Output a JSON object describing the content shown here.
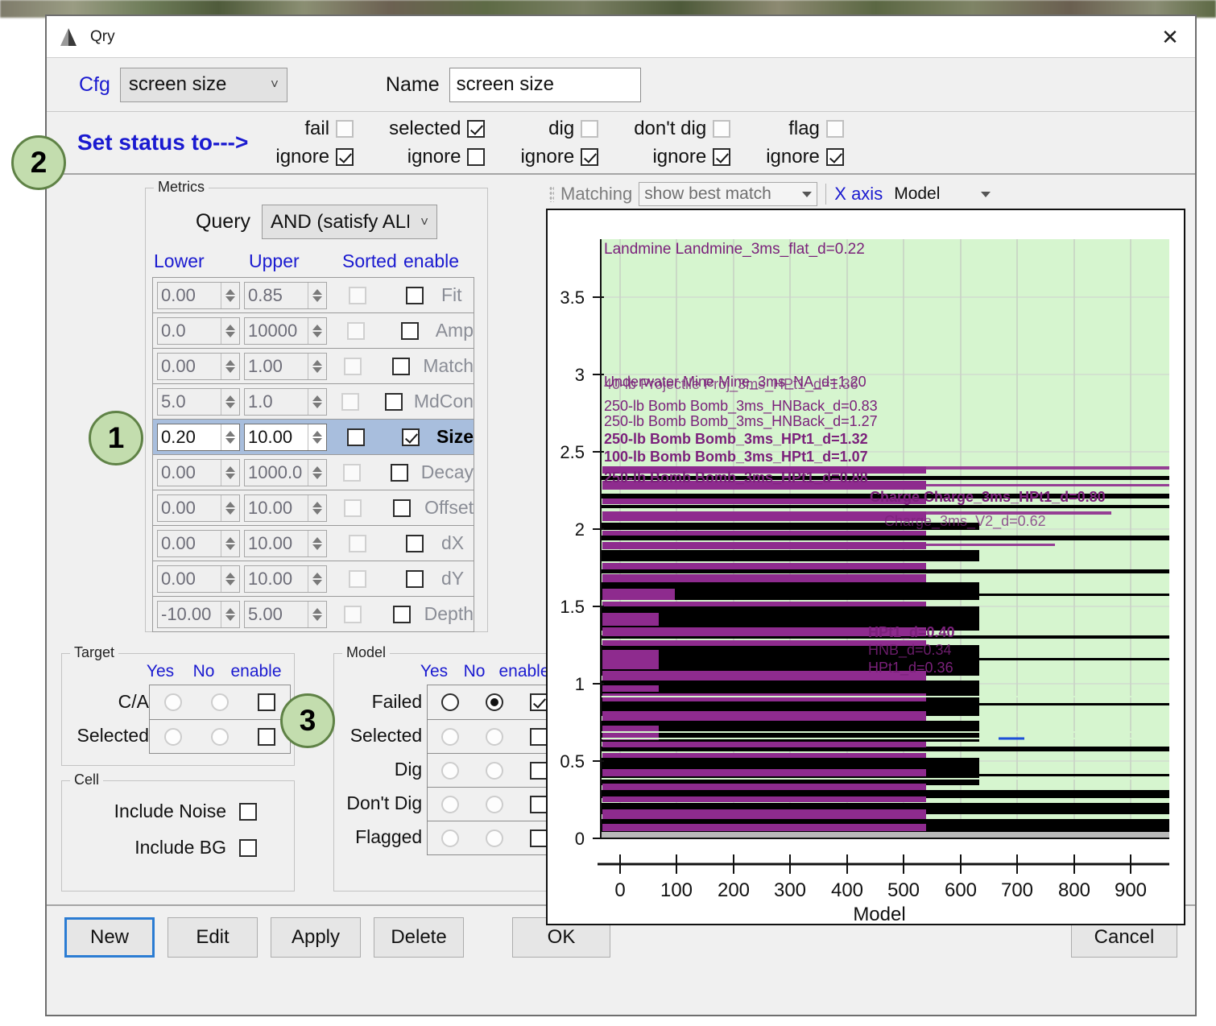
{
  "window": {
    "title": "Qry",
    "close_label": "✕"
  },
  "cfg_row": {
    "cfg_label": "Cfg",
    "cfg_value": "screen size",
    "name_label": "Name",
    "name_value": "screen size"
  },
  "status_row": {
    "title": "Set status to--->",
    "groups": [
      {
        "name": "fail",
        "top_label": "fail",
        "top_checked": false,
        "top_enabled": false,
        "ignore_label": "ignore",
        "ignore_checked": true
      },
      {
        "name": "selected",
        "top_label": "selected",
        "top_checked": true,
        "top_enabled": true,
        "ignore_label": "ignore",
        "ignore_checked": false
      },
      {
        "name": "dig",
        "top_label": "dig",
        "top_checked": false,
        "top_enabled": false,
        "ignore_label": "ignore",
        "ignore_checked": true
      },
      {
        "name": "dont-dig",
        "top_label": "don't dig",
        "top_checked": false,
        "top_enabled": false,
        "ignore_label": "ignore",
        "ignore_checked": true
      },
      {
        "name": "flag",
        "top_label": "flag",
        "top_checked": false,
        "top_enabled": false,
        "ignore_label": "ignore",
        "ignore_checked": true
      }
    ]
  },
  "metrics": {
    "group_title": "Metrics",
    "query_label": "Query",
    "query_value": "AND (satisfy ALL)",
    "headers": {
      "lower": "Lower",
      "upper": "Upper",
      "sorted": "Sorted",
      "enable": "enable"
    },
    "rows": [
      {
        "name": "Fit",
        "lower": "0.00",
        "upper": "0.85",
        "sorted": false,
        "enabled": false,
        "selected": false
      },
      {
        "name": "Amp",
        "lower": "0.0",
        "upper": "10000",
        "sorted": false,
        "enabled": false,
        "selected": false
      },
      {
        "name": "Match",
        "lower": "0.00",
        "upper": "1.00",
        "sorted": false,
        "enabled": false,
        "selected": false
      },
      {
        "name": "MdCon",
        "lower": "5.0",
        "upper": "1.0",
        "sorted": false,
        "enabled": false,
        "selected": false
      },
      {
        "name": "Size",
        "lower": "0.20",
        "upper": "10.00",
        "sorted": false,
        "enabled": true,
        "selected": true
      },
      {
        "name": "Decay",
        "lower": "0.00",
        "upper": "1000.0",
        "sorted": false,
        "enabled": false,
        "selected": false
      },
      {
        "name": "Offset",
        "lower": "0.00",
        "upper": "10.00",
        "sorted": false,
        "enabled": false,
        "selected": false
      },
      {
        "name": "dX",
        "lower": "0.00",
        "upper": "10.00",
        "sorted": false,
        "enabled": false,
        "selected": false
      },
      {
        "name": "dY",
        "lower": "0.00",
        "upper": "10.00",
        "sorted": false,
        "enabled": false,
        "selected": false
      },
      {
        "name": "Depth",
        "lower": "-10.00",
        "upper": "5.00",
        "sorted": false,
        "enabled": false,
        "selected": false
      }
    ]
  },
  "target": {
    "group_title": "Target",
    "headers": {
      "yes": "Yes",
      "no": "No",
      "enable": "enable"
    },
    "rows": [
      {
        "label": "C/A",
        "yes": false,
        "no": false,
        "active": false,
        "enable": false
      },
      {
        "label": "Selected",
        "yes": false,
        "no": false,
        "active": false,
        "enable": false
      }
    ]
  },
  "cell": {
    "group_title": "Cell",
    "rows": [
      {
        "label": "Include Noise",
        "checked": false
      },
      {
        "label": "Include BG",
        "checked": false
      }
    ]
  },
  "model": {
    "group_title": "Model",
    "headers": {
      "yes": "Yes",
      "no": "No",
      "enable": "enable"
    },
    "rows": [
      {
        "label": "Failed",
        "yes": false,
        "no": true,
        "active": true,
        "enable": true
      },
      {
        "label": "Selected",
        "yes": false,
        "no": false,
        "active": false,
        "enable": false
      },
      {
        "label": "Dig",
        "yes": false,
        "no": false,
        "active": false,
        "enable": false
      },
      {
        "label": "Don't Dig",
        "yes": false,
        "no": false,
        "active": false,
        "enable": false
      },
      {
        "label": "Flagged",
        "yes": false,
        "no": false,
        "active": false,
        "enable": false
      }
    ]
  },
  "plot_toolbar": {
    "matching_label": "Matching",
    "matching_value": "show best match",
    "xaxis_label": "X axis",
    "xaxis_value": "Model"
  },
  "badges": [
    {
      "number": "1"
    },
    {
      "number": "2"
    },
    {
      "number": "3"
    }
  ],
  "footer": {
    "new": "New",
    "edit": "Edit",
    "apply": "Apply",
    "delete": "Delete",
    "ok": "OK",
    "cancel": "Cancel"
  },
  "chart_data": {
    "type": "scatter",
    "title": "",
    "xlabel": "Model",
    "ylabel": "",
    "xlim": [
      -30,
      970
    ],
    "ylim": [
      -0.12,
      3.9
    ],
    "xticks": [
      0,
      100,
      200,
      300,
      400,
      500,
      600,
      700,
      800,
      900
    ],
    "yticks": [
      0,
      0.5,
      1,
      1.5,
      2,
      2.5,
      3,
      3.5
    ],
    "grid": true,
    "band_color": "#d6f5cf",
    "band_range": [
      0.2,
      10.0
    ],
    "dense_color": "#8e2b8e",
    "dark_color": "#000000",
    "legend": "none",
    "annotations": [
      {
        "label": "Landmine Landmine_3ms_flat_d=0.22",
        "y": 3.82
      },
      {
        "label": "Underwater Mine Mine_3ms_NA_d=1.20",
        "y": 3.04
      },
      {
        "label": "40-lb Projectile Proj_3ms_HPt1_d=1.36",
        "y": 3.02
      },
      {
        "label": "250-lb Bomb Bomb_3ms_HNBack_d=0.83",
        "y": 2.89
      },
      {
        "label": "250-lb Bomb Bomb_3ms_HNBack_d=1.27",
        "y": 2.81
      },
      {
        "label": "250-lb Bomb Bomb_3ms_HPt1_d=1.32",
        "y": 2.72
      },
      {
        "label": "100-lb Bomb Bomb_3ms_HPt1_d=1.07",
        "y": 2.62
      },
      {
        "label": "250-lb Bomb Bomb_3ms_HPt1_d=0.88",
        "y": 2.5
      },
      {
        "label": "Charge Charge_3ms_HPt1_d=0.80",
        "y": 2.17
      },
      {
        "label": "Charge_3ms_V2_d=0.62",
        "y": 2.02
      },
      {
        "label": "HPt1_d=0.40",
        "y": 1.32
      },
      {
        "label": "HNB_d=0.34",
        "y": 1.22
      },
      {
        "label": "HPt1_d=0.36",
        "y": 1.14
      }
    ]
  }
}
